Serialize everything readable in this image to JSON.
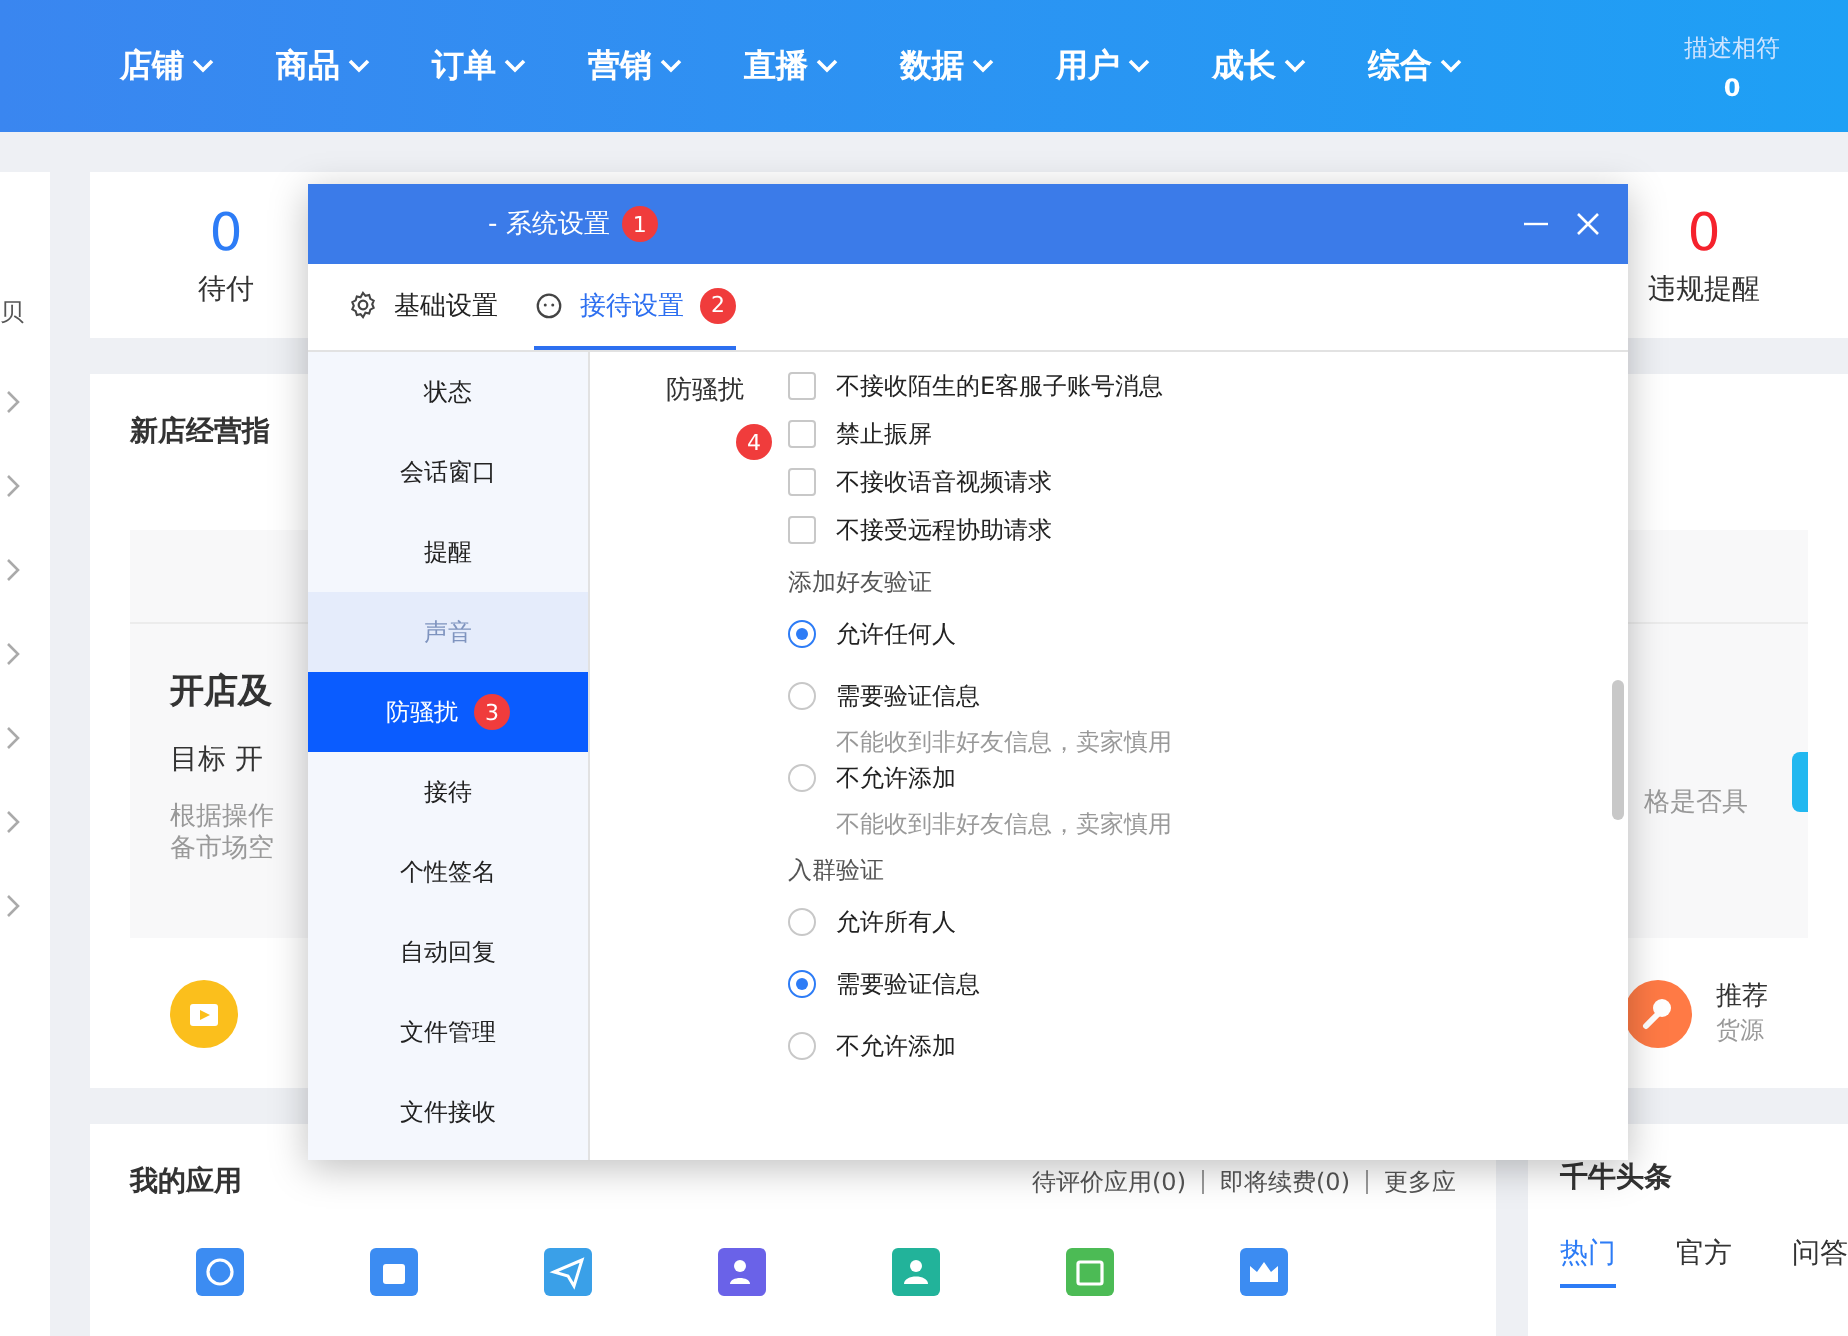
{
  "top_nav": {
    "items": [
      {
        "label": "店铺"
      },
      {
        "label": "商品"
      },
      {
        "label": "订单"
      },
      {
        "label": "营销"
      },
      {
        "label": "直播"
      },
      {
        "label": "数据"
      },
      {
        "label": "用户"
      },
      {
        "label": "成长"
      },
      {
        "label": "综合"
      }
    ],
    "rating": {
      "label": "描述相符",
      "value": "0"
    }
  },
  "sidebar": {
    "partial_text": "贝"
  },
  "stats": [
    {
      "value": "0",
      "label": "待付",
      "color": "#2d7cf6"
    },
    {
      "value": "0",
      "label": "违规提醒",
      "color": "#f5222d"
    }
  ],
  "guide_card": {
    "title": "新店经营指",
    "task_title": "开店及",
    "goal": "目标 开",
    "desc_lines": [
      "根据操作",
      "备市场空"
    ],
    "desc_right": "格是否具",
    "links": [
      {
        "kind": "video"
      },
      {
        "kind": "tool",
        "title": "推荐",
        "subtitle": "货源"
      }
    ]
  },
  "apps_card": {
    "title": "我的应用",
    "links": [
      "待评价应用(0)",
      "即将续费(0)",
      "更多应"
    ],
    "apps": [
      {
        "kind": "compass"
      },
      {
        "kind": "bag"
      },
      {
        "kind": "plane"
      },
      {
        "kind": "person"
      },
      {
        "kind": "people"
      },
      {
        "kind": "calendar"
      },
      {
        "kind": "crown"
      }
    ]
  },
  "headline_card": {
    "title": "千牛头条",
    "tabs": [
      {
        "label": "热门",
        "selected": true
      },
      {
        "label": "官方",
        "selected": false
      },
      {
        "label": "问答",
        "selected": false
      }
    ]
  },
  "dialog": {
    "title": "- 系统设置",
    "badge": "1",
    "tabs": [
      {
        "label": "基础设置",
        "selected": false,
        "kind": "gear"
      },
      {
        "label": "接待设置",
        "selected": true,
        "kind": "face",
        "badge": "2"
      }
    ],
    "nav": [
      {
        "label": "状态",
        "selected": false,
        "hovered": false
      },
      {
        "label": "会话窗口",
        "selected": false,
        "hovered": false
      },
      {
        "label": "提醒",
        "selected": false,
        "hovered": false
      },
      {
        "label": "声音",
        "selected": false,
        "hovered": true
      },
      {
        "label": "防骚扰",
        "selected": true,
        "hovered": false,
        "badge": "3"
      },
      {
        "label": "接待",
        "selected": false,
        "hovered": false
      },
      {
        "label": "个性签名",
        "selected": false,
        "hovered": false
      },
      {
        "label": "自动回复",
        "selected": false,
        "hovered": false
      },
      {
        "label": "文件管理",
        "selected": false,
        "hovered": false
      },
      {
        "label": "文件接收",
        "selected": false,
        "hovered": false
      }
    ],
    "section_label": "防骚扰",
    "section_badge": "4",
    "options": [
      {
        "label": "不接收陌生的E客服子账号消息",
        "checked": false
      },
      {
        "label": "禁止振屏",
        "checked": false
      },
      {
        "label": "不接收语音视频请求",
        "checked": false
      },
      {
        "label": "不接受远程协助请求",
        "checked": false
      }
    ],
    "groups": [
      {
        "title": "添加好友验证",
        "choices": [
          {
            "label": "允许任何人",
            "selected": true
          },
          {
            "label": "需要验证信息",
            "selected": false,
            "hint": "不能收到非好友信息，卖家慎用"
          },
          {
            "label": "不允许添加",
            "selected": false,
            "hint": "不能收到非好友信息，卖家慎用"
          }
        ]
      },
      {
        "title": "入群验证",
        "choices": [
          {
            "label": "允许所有人",
            "selected": false
          },
          {
            "label": "需要验证信息",
            "selected": true
          },
          {
            "label": "不允许添加",
            "selected": false
          }
        ]
      }
    ]
  }
}
